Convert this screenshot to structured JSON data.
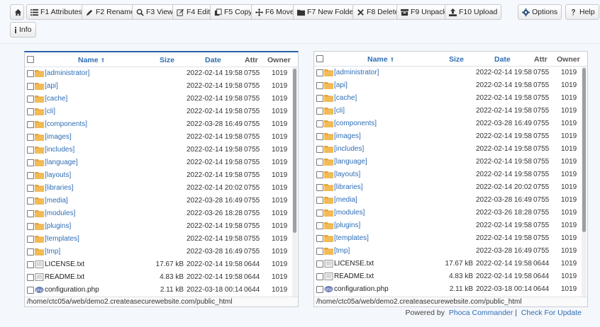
{
  "toolbar": {
    "buttons": [
      {
        "key": "home",
        "label": ""
      },
      {
        "key": "attributes",
        "label": "F1 Attributes"
      },
      {
        "key": "rename",
        "label": "F2 Rename"
      },
      {
        "key": "view",
        "label": "F3 View"
      },
      {
        "key": "edit",
        "label": "F4 Edit"
      },
      {
        "key": "copy",
        "label": "F5 Copy"
      },
      {
        "key": "move",
        "label": "F6 Move"
      },
      {
        "key": "new_folder",
        "label": "F7 New Folder"
      },
      {
        "key": "delete",
        "label": "F8 Delete"
      },
      {
        "key": "unpack",
        "label": "F9 Unpack"
      },
      {
        "key": "upload",
        "label": "F10 Upload"
      },
      {
        "key": "options",
        "label": "Options"
      },
      {
        "key": "help",
        "label": "Help"
      },
      {
        "key": "info",
        "label": "Info"
      }
    ]
  },
  "columns": {
    "name": "Name",
    "size": "Size",
    "date": "Date",
    "attr": "Attr",
    "owner": "Owner"
  },
  "panels": [
    {
      "path": "/home/ctc05a/web/demo2.createasecurewebsite.com/public_html",
      "rows": [
        {
          "name": "[administrator]",
          "type": "folder",
          "size": "",
          "date": "2022-02-14 19:58",
          "attr": "0755",
          "owner": "1019"
        },
        {
          "name": "[api]",
          "type": "folder",
          "size": "",
          "date": "2022-02-14 19:58",
          "attr": "0755",
          "owner": "1019"
        },
        {
          "name": "[cache]",
          "type": "folder",
          "size": "",
          "date": "2022-02-14 19:58",
          "attr": "0755",
          "owner": "1019"
        },
        {
          "name": "[cli]",
          "type": "folder",
          "size": "",
          "date": "2022-02-14 19:58",
          "attr": "0755",
          "owner": "1019"
        },
        {
          "name": "[components]",
          "type": "folder",
          "size": "",
          "date": "2022-03-28 16:49",
          "attr": "0755",
          "owner": "1019"
        },
        {
          "name": "[images]",
          "type": "folder",
          "size": "",
          "date": "2022-02-14 19:58",
          "attr": "0755",
          "owner": "1019"
        },
        {
          "name": "[includes]",
          "type": "folder",
          "size": "",
          "date": "2022-02-14 19:58",
          "attr": "0755",
          "owner": "1019"
        },
        {
          "name": "[language]",
          "type": "folder",
          "size": "",
          "date": "2022-02-14 19:58",
          "attr": "0755",
          "owner": "1019"
        },
        {
          "name": "[layouts]",
          "type": "folder",
          "size": "",
          "date": "2022-02-14 19:58",
          "attr": "0755",
          "owner": "1019"
        },
        {
          "name": "[libraries]",
          "type": "folder",
          "size": "",
          "date": "2022-02-14 20:02",
          "attr": "0755",
          "owner": "1019"
        },
        {
          "name": "[media]",
          "type": "folder",
          "size": "",
          "date": "2022-03-28 16:49",
          "attr": "0755",
          "owner": "1019"
        },
        {
          "name": "[modules]",
          "type": "folder",
          "size": "",
          "date": "2022-03-26 18:28",
          "attr": "0755",
          "owner": "1019"
        },
        {
          "name": "[plugins]",
          "type": "folder",
          "size": "",
          "date": "2022-02-14 19:58",
          "attr": "0755",
          "owner": "1019"
        },
        {
          "name": "[templates]",
          "type": "folder",
          "size": "",
          "date": "2022-02-14 19:58",
          "attr": "0755",
          "owner": "1019"
        },
        {
          "name": "[tmp]",
          "type": "folder",
          "size": "",
          "date": "2022-03-28 16:49",
          "attr": "0755",
          "owner": "1019"
        },
        {
          "name": "LICENSE.txt",
          "type": "text",
          "size": "17.67 kB",
          "date": "2022-02-14 19:58",
          "attr": "0644",
          "owner": "1019"
        },
        {
          "name": "README.txt",
          "type": "text",
          "size": "4.83 kB",
          "date": "2022-02-14 19:58",
          "attr": "0644",
          "owner": "1019"
        },
        {
          "name": "configuration.php",
          "type": "php",
          "size": "2.11 kB",
          "date": "2022-03-18 00:14",
          "attr": "0644",
          "owner": "1019"
        }
      ]
    },
    {
      "path": "/home/ctc05a/web/demo2.createasecurewebsite.com/public_html",
      "rows": [
        {
          "name": "[administrator]",
          "type": "folder",
          "size": "",
          "date": "2022-02-14 19:58",
          "attr": "0755",
          "owner": "1019"
        },
        {
          "name": "[api]",
          "type": "folder",
          "size": "",
          "date": "2022-02-14 19:58",
          "attr": "0755",
          "owner": "1019"
        },
        {
          "name": "[cache]",
          "type": "folder",
          "size": "",
          "date": "2022-02-14 19:58",
          "attr": "0755",
          "owner": "1019"
        },
        {
          "name": "[cli]",
          "type": "folder",
          "size": "",
          "date": "2022-02-14 19:58",
          "attr": "0755",
          "owner": "1019"
        },
        {
          "name": "[components]",
          "type": "folder",
          "size": "",
          "date": "2022-03-28 16:49",
          "attr": "0755",
          "owner": "1019"
        },
        {
          "name": "[images]",
          "type": "folder",
          "size": "",
          "date": "2022-02-14 19:58",
          "attr": "0755",
          "owner": "1019"
        },
        {
          "name": "[includes]",
          "type": "folder",
          "size": "",
          "date": "2022-02-14 19:58",
          "attr": "0755",
          "owner": "1019"
        },
        {
          "name": "[language]",
          "type": "folder",
          "size": "",
          "date": "2022-02-14 19:58",
          "attr": "0755",
          "owner": "1019"
        },
        {
          "name": "[layouts]",
          "type": "folder",
          "size": "",
          "date": "2022-02-14 19:58",
          "attr": "0755",
          "owner": "1019"
        },
        {
          "name": "[libraries]",
          "type": "folder",
          "size": "",
          "date": "2022-02-14 20:02",
          "attr": "0755",
          "owner": "1019"
        },
        {
          "name": "[media]",
          "type": "folder",
          "size": "",
          "date": "2022-03-28 16:49",
          "attr": "0755",
          "owner": "1019"
        },
        {
          "name": "[modules]",
          "type": "folder",
          "size": "",
          "date": "2022-03-26 18:28",
          "attr": "0755",
          "owner": "1019"
        },
        {
          "name": "[plugins]",
          "type": "folder",
          "size": "",
          "date": "2022-02-14 19:58",
          "attr": "0755",
          "owner": "1019"
        },
        {
          "name": "[templates]",
          "type": "folder",
          "size": "",
          "date": "2022-02-14 19:58",
          "attr": "0755",
          "owner": "1019"
        },
        {
          "name": "[tmp]",
          "type": "folder",
          "size": "",
          "date": "2022-03-28 16:49",
          "attr": "0755",
          "owner": "1019"
        },
        {
          "name": "LICENSE.txt",
          "type": "text",
          "size": "17.67 kB",
          "date": "2022-02-14 19:58",
          "attr": "0644",
          "owner": "1019"
        },
        {
          "name": "README.txt",
          "type": "text",
          "size": "4.83 kB",
          "date": "2022-02-14 19:58",
          "attr": "0644",
          "owner": "1019"
        },
        {
          "name": "configuration.php",
          "type": "php",
          "size": "2.11 kB",
          "date": "2022-03-18 00:14",
          "attr": "0644",
          "owner": "1019"
        }
      ]
    }
  ],
  "footer": {
    "powered_by": "Powered by",
    "product": "Phoca Commander",
    "separator": "|",
    "check_update": "Check For Update"
  },
  "colors": {
    "accent": "#2f6eb5",
    "folder": "#e8a33a",
    "active_border": "#2b5fa8"
  }
}
